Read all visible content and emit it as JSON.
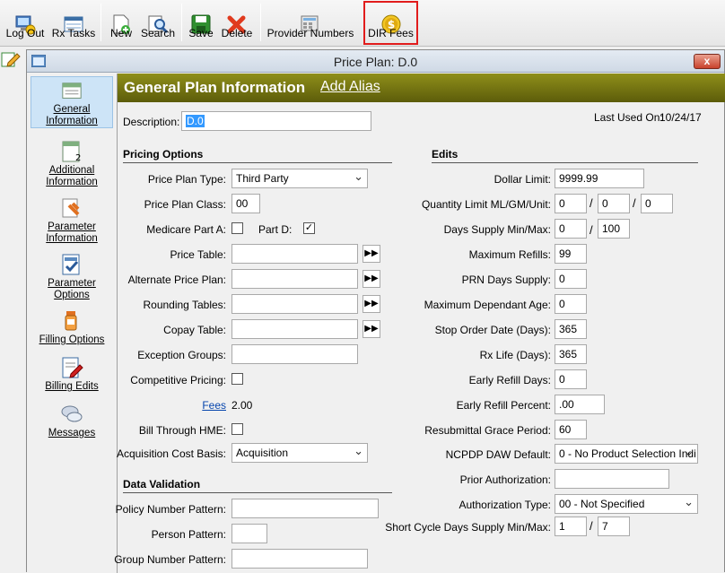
{
  "toolbar": {
    "log_out": "Log Out",
    "rx_tasks": "Rx Tasks",
    "new": "New",
    "search": "Search",
    "save": "Save",
    "delete": "Delete",
    "provider_numbers": "Provider Numbers",
    "dir_fees": "DIR Fees"
  },
  "window": {
    "title": "Price Plan: D.0",
    "close": "x"
  },
  "nav": {
    "general": "General Information",
    "additional": "Additional Information",
    "parameter_info": "Parameter Information",
    "parameter_options": "Parameter Options",
    "filling": "Filling Options",
    "billing": "Billing Edits",
    "messages": "Messages"
  },
  "header": {
    "title": "General Plan Information",
    "add_alias": "Add Alias"
  },
  "description": {
    "label": "Description:",
    "value": "D.0"
  },
  "last_used": {
    "label": "Last Used On:",
    "value": "10/24/17"
  },
  "pricing": {
    "section": "Pricing Options",
    "plan_type_label": "Price Plan Type:",
    "plan_type": "Third Party",
    "plan_class_label": "Price Plan Class:",
    "plan_class": "00",
    "medicare_label": "Medicare Part A:",
    "medicare_a": false,
    "part_d_label": "Part D:",
    "part_d": true,
    "price_table_label": "Price Table:",
    "price_table": "",
    "alt_plan_label": "Alternate Price Plan:",
    "alt_plan": "",
    "rounding_label": "Rounding Tables:",
    "rounding": "",
    "copay_label": "Copay Table:",
    "copay": "",
    "exception_label": "Exception Groups:",
    "exception": "",
    "competitive_label": "Competitive Pricing:",
    "competitive": false,
    "fees_label": "Fees",
    "fees_value": "2.00",
    "hme_label": "Bill Through HME:",
    "hme": false,
    "acq_label": "Acquisition Cost Basis:",
    "acq_value": "Acquisition",
    "arrow": "▶▶"
  },
  "validation": {
    "section": "Data Validation",
    "policy_label": "Policy Number Pattern:",
    "policy": "",
    "person_label": "Person Pattern:",
    "person": "",
    "group_label": "Group Number Pattern:",
    "group": ""
  },
  "edits": {
    "section": "Edits",
    "dollar_limit_label": "Dollar Limit:",
    "dollar_limit": "9999.99",
    "qty_label": "Quantity Limit ML/GM/Unit:",
    "qty1": "0",
    "qty2": "0",
    "qty3": "0",
    "days_supply_label": "Days Supply Min/Max:",
    "days_min": "0",
    "days_max": "100",
    "max_refills_label": "Maximum Refills:",
    "max_refills": "99",
    "prn_label": "PRN Days Supply:",
    "prn": "0",
    "dep_age_label": "Maximum Dependant Age:",
    "dep_age": "0",
    "stop_order_label": "Stop Order Date (Days):",
    "stop_order": "365",
    "rx_life_label": "Rx Life (Days):",
    "rx_life": "365",
    "early_days_label": "Early Refill Days:",
    "early_days": "0",
    "early_pct_label": "Early Refill Percent:",
    "early_pct": ".00",
    "grace_label": "Resubmittal Grace Period:",
    "grace": "60",
    "daw_label": "NCPDP DAW Default:",
    "daw": "0 - No Product Selection Indi",
    "prior_auth_label": "Prior Authorization:",
    "prior_auth": "",
    "auth_type_label": "Authorization Type:",
    "auth_type": "00 - Not Specified",
    "short_cycle_label": "Short Cycle Days Supply Min/Max:",
    "short_min": "1",
    "short_max": "7",
    "slash": "/"
  },
  "icons": [
    "logout-icon",
    "rx-tasks-icon",
    "new-icon",
    "search-icon",
    "save-icon",
    "delete-icon",
    "provider-numbers-icon",
    "dir-fees-icon"
  ]
}
